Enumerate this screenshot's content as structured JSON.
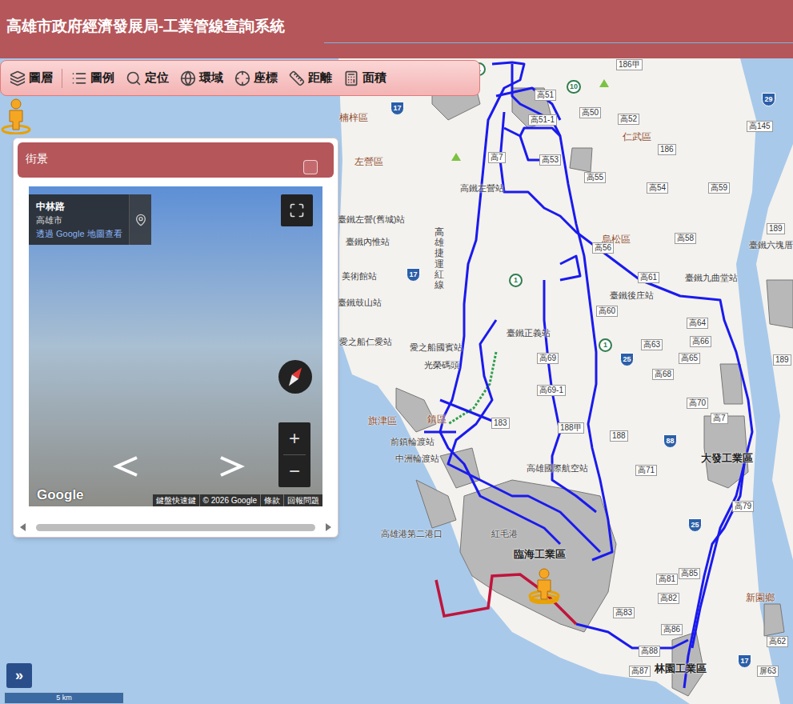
{
  "window": {
    "title": "高雄市政府經濟發展局-工業管線查詢系統"
  },
  "toolbar": {
    "items": [
      {
        "label": "圖層"
      },
      {
        "label": "圖例"
      },
      {
        "label": "定位"
      },
      {
        "label": "環域"
      },
      {
        "label": "座標"
      },
      {
        "label": "距離"
      },
      {
        "label": "面積"
      }
    ]
  },
  "streetview": {
    "title": "街景",
    "location_name": "中林路",
    "city": "高雄市",
    "link": "透過 Google 地圖查看",
    "logo": "Google",
    "footer": [
      "鍵盤快速鍵",
      "© 2026 Google",
      "條款",
      "回報問題"
    ],
    "zoom_in": "+",
    "zoom_out": "−"
  },
  "map": {
    "labels": [
      {
        "text": "楠梓區",
        "kind": "district"
      },
      {
        "text": "左營區",
        "kind": "district"
      },
      {
        "text": "仁武區",
        "kind": "district"
      },
      {
        "text": "烏松區",
        "kind": "district"
      },
      {
        "text": "旗津區",
        "kind": "district"
      },
      {
        "text": "鎮區",
        "kind": "district"
      },
      {
        "text": "新園鄉",
        "kind": "district"
      },
      {
        "text": "大發工業區",
        "kind": "industrial"
      },
      {
        "text": "臨海工業區",
        "kind": "industrial"
      },
      {
        "text": "林園工業區",
        "kind": "industrial"
      },
      {
        "text": "高鐵左營站",
        "kind": "station"
      },
      {
        "text": "臺鐵左營(舊城)站",
        "kind": "station"
      },
      {
        "text": "臺鐵內惟站",
        "kind": "station"
      },
      {
        "text": "美術館站",
        "kind": "station"
      },
      {
        "text": "臺鐵鼓山站",
        "kind": "station"
      },
      {
        "text": "愛之船仁愛站",
        "kind": "station"
      },
      {
        "text": "愛之船國賓站",
        "kind": "station"
      },
      {
        "text": "光榮碼頭",
        "kind": "station"
      },
      {
        "text": "臺鐵正義站",
        "kind": "station"
      },
      {
        "text": "臺鐵後庄站",
        "kind": "station"
      },
      {
        "text": "臺鐵九曲堂站",
        "kind": "station"
      },
      {
        "text": "臺鐵六塊厝",
        "kind": "station"
      },
      {
        "text": "前鎮輪渡站",
        "kind": "station"
      },
      {
        "text": "中洲輪渡站",
        "kind": "station"
      },
      {
        "text": "高雄國際航空站",
        "kind": "station"
      },
      {
        "text": "高雄港第二港口",
        "kind": "station"
      },
      {
        "text": "紅毛港",
        "kind": "station"
      },
      {
        "text": "高雄捷運紅線",
        "kind": "vertical"
      },
      {
        "text": "186甲",
        "kind": "road"
      },
      {
        "text": "高51",
        "kind": "road"
      },
      {
        "text": "高50",
        "kind": "road"
      },
      {
        "text": "高52",
        "kind": "road"
      },
      {
        "text": "高51-1",
        "kind": "road"
      },
      {
        "text": "高145",
        "kind": "road"
      },
      {
        "text": "186",
        "kind": "road"
      },
      {
        "text": "高7",
        "kind": "road"
      },
      {
        "text": "高53",
        "kind": "road"
      },
      {
        "text": "高55",
        "kind": "road"
      },
      {
        "text": "高54",
        "kind": "road"
      },
      {
        "text": "高59",
        "kind": "road"
      },
      {
        "text": "189",
        "kind": "road"
      },
      {
        "text": "高58",
        "kind": "road"
      },
      {
        "text": "高56",
        "kind": "road"
      },
      {
        "text": "高61",
        "kind": "road"
      },
      {
        "text": "高60",
        "kind": "road"
      },
      {
        "text": "高64",
        "kind": "road"
      },
      {
        "text": "高66",
        "kind": "road"
      },
      {
        "text": "高63",
        "kind": "road"
      },
      {
        "text": "高65",
        "kind": "road"
      },
      {
        "text": "高69",
        "kind": "road"
      },
      {
        "text": "189",
        "kind": "road"
      },
      {
        "text": "高68",
        "kind": "road"
      },
      {
        "text": "高69-1",
        "kind": "road"
      },
      {
        "text": "高70",
        "kind": "road"
      },
      {
        "text": "高7",
        "kind": "road"
      },
      {
        "text": "183",
        "kind": "road"
      },
      {
        "text": "188甲",
        "kind": "road"
      },
      {
        "text": "188",
        "kind": "road"
      },
      {
        "text": "高71",
        "kind": "road"
      },
      {
        "text": "高79",
        "kind": "road"
      },
      {
        "text": "高85",
        "kind": "road"
      },
      {
        "text": "高81",
        "kind": "road"
      },
      {
        "text": "高82",
        "kind": "road"
      },
      {
        "text": "高83",
        "kind": "road"
      },
      {
        "text": "高86",
        "kind": "road"
      },
      {
        "text": "高62",
        "kind": "road"
      },
      {
        "text": "高88",
        "kind": "road"
      },
      {
        "text": "高87",
        "kind": "road"
      },
      {
        "text": "屏63",
        "kind": "road"
      },
      {
        "text": "1",
        "kind": "freeway"
      },
      {
        "text": "10",
        "kind": "freeway"
      },
      {
        "text": "17",
        "kind": "provincial"
      },
      {
        "text": "29",
        "kind": "provincial"
      },
      {
        "text": "1",
        "kind": "freeway"
      },
      {
        "text": "17",
        "kind": "provincial"
      },
      {
        "text": "1",
        "kind": "freeway"
      },
      {
        "text": "25",
        "kind": "provincial"
      },
      {
        "text": "88",
        "kind": "provincial"
      },
      {
        "text": "25",
        "kind": "provincial"
      },
      {
        "text": "17",
        "kind": "provincial"
      }
    ]
  },
  "controls": {
    "expand": "»",
    "scale": "5 km"
  }
}
